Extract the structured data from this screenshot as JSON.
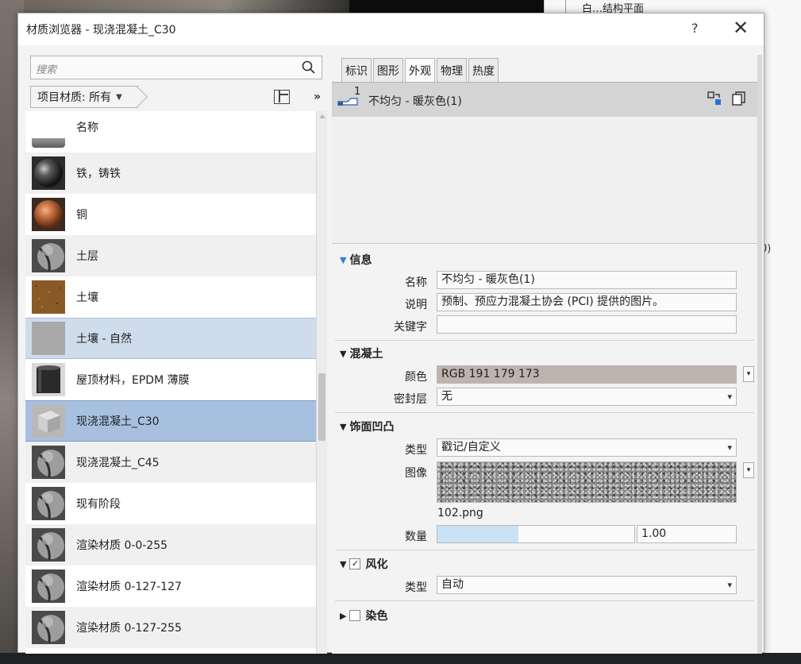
{
  "dialog": {
    "title": "材质浏览器 - 现浇混凝土_C30",
    "help": "?",
    "close": "✕"
  },
  "background": {
    "tree_item": "白…结构平面",
    "edge_chars": [
      ")",
      ")",
      "0)"
    ]
  },
  "library": {
    "search_placeholder": "搜索",
    "filter_label": "项目材质: 所有",
    "filter_caret": "▼",
    "collapse": "»",
    "header": "名称",
    "items": [
      {
        "label": "铁，铸铁",
        "thumb": "sphere-dark"
      },
      {
        "label": "铜",
        "thumb": "sphere-copper"
      },
      {
        "label": "土层",
        "thumb": "default-material"
      },
      {
        "label": "土壤",
        "thumb": "soil"
      },
      {
        "label": "土壤 - 自然",
        "thumb": "grey-square"
      },
      {
        "label": "屋顶材料，EPDM 薄膜",
        "thumb": "epdm-cylinder"
      },
      {
        "label": "现浇混凝土_C30",
        "thumb": "concrete-cube"
      },
      {
        "label": "现浇混凝土_C45",
        "thumb": "default-material"
      },
      {
        "label": "现有阶段",
        "thumb": "default-material"
      },
      {
        "label": "渲染材质 0-0-255",
        "thumb": "default-material"
      },
      {
        "label": "渲染材质 0-127-127",
        "thumb": "default-material"
      },
      {
        "label": "渲染材质 0-127-255",
        "thumb": "default-material"
      }
    ]
  },
  "editor": {
    "tabs": [
      "标识",
      "图形",
      "外观",
      "物理",
      "热度"
    ],
    "active_tab": "外观",
    "asset": {
      "count": "1",
      "name": "不均匀 - 暖灰色(1)"
    },
    "sections": {
      "info": {
        "title": "信息",
        "name_label": "名称",
        "name_value": "不均匀 - 暖灰色(1)",
        "desc_label": "说明",
        "desc_value": "预制、预应力混凝土协会 (PCI) 提供的图片。",
        "keyword_label": "关键字",
        "keyword_value": ""
      },
      "concrete": {
        "title": "混凝土",
        "color_label": "颜色",
        "color_value": "RGB 191 179 173",
        "color_hex": "#bfb3ad",
        "seal_label": "密封层",
        "seal_value": "无"
      },
      "bump": {
        "title": "饰面凹凸",
        "type_label": "类型",
        "type_value": "戳记/自定义",
        "image_label": "图像",
        "image_file": "102.png",
        "amount_label": "数量",
        "amount_value": "1.00",
        "amount_fraction": 0.41
      },
      "weathering": {
        "title": "风化",
        "checked": "✓",
        "type_label": "类型",
        "type_value": "自动"
      },
      "tint": {
        "title": "染色"
      }
    }
  }
}
